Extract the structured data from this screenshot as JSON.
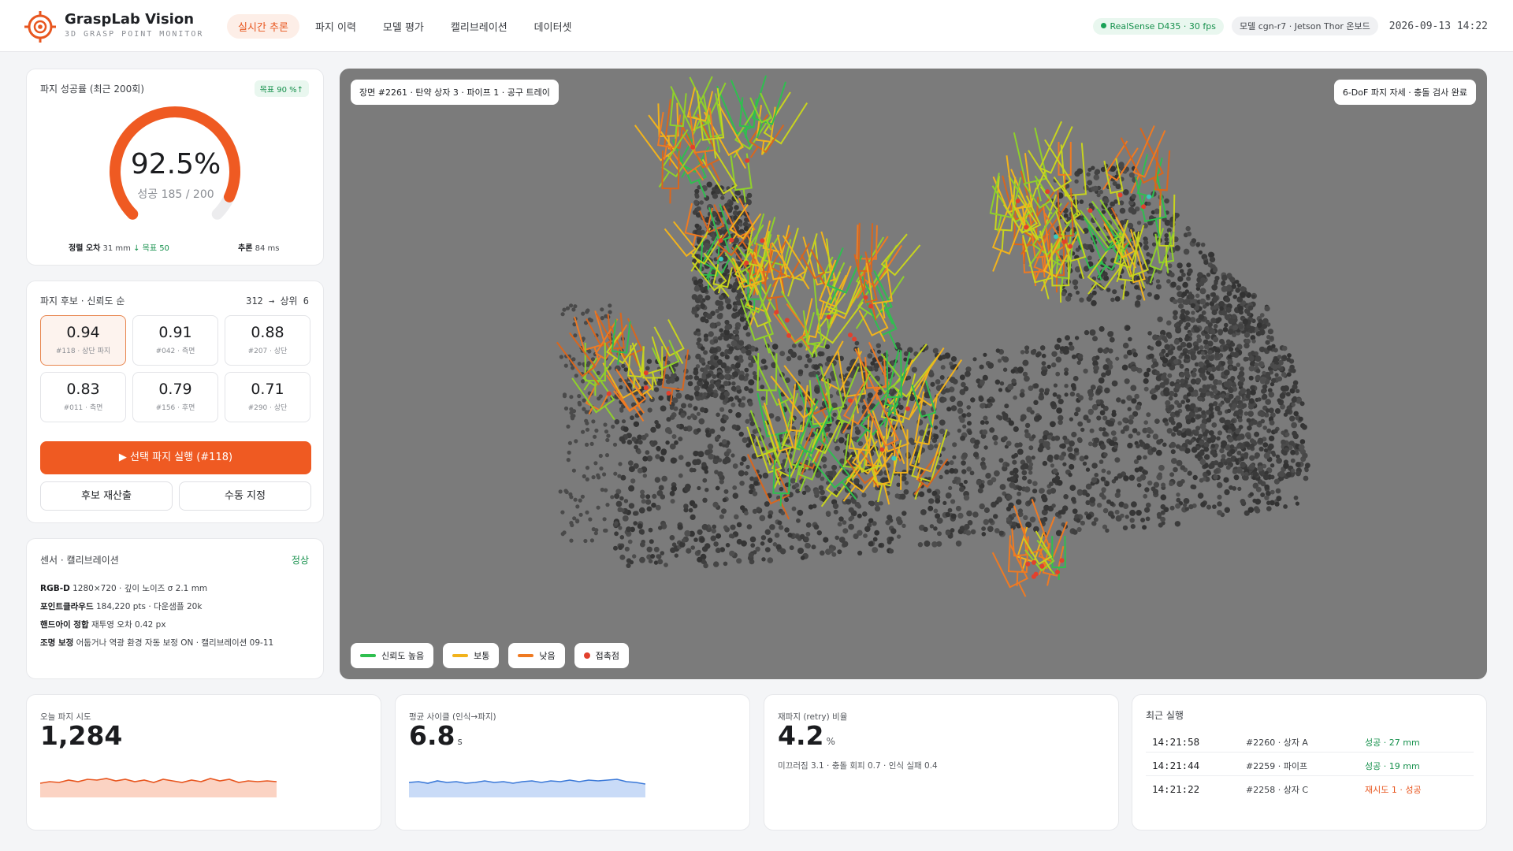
{
  "header": {
    "brand": "GraspLab Vision",
    "subtitle": "3D GRASP POINT MONITOR",
    "nav": [
      {
        "label": "실시간 추론",
        "active": true
      },
      {
        "label": "파지 이력",
        "active": false
      },
      {
        "label": "모델 평가",
        "active": false
      },
      {
        "label": "캘리브레이션",
        "active": false
      },
      {
        "label": "데이터셋",
        "active": false
      }
    ],
    "camera_status": "RealSense D435 · 30 fps",
    "model_info": "모델 cgn-r7 · Jetson Thor 온보드",
    "datetime": "2026-09-13 14:22"
  },
  "success": {
    "title": "파지 성공률 (최근 200회)",
    "target_badge": "목표 90 %↑",
    "rate_text": "92.5%",
    "rate_fraction": 0.925,
    "detail": "성공 185 / 200",
    "align_label": "정렬 오차",
    "align_value": "31 mm",
    "align_target": "↓ 목표 50",
    "infer_label": "추론",
    "infer_value": "84 ms"
  },
  "candidates": {
    "title": "파지 후보 · 신뢰도 순",
    "count": "312 → 상위 6",
    "items": [
      {
        "score": "0.94",
        "meta": "#118 · 상단 파지",
        "selected": true
      },
      {
        "score": "0.91",
        "meta": "#042 · 측면",
        "selected": false
      },
      {
        "score": "0.88",
        "meta": "#207 · 상단",
        "selected": false
      },
      {
        "score": "0.83",
        "meta": "#011 · 측면",
        "selected": false
      },
      {
        "score": "0.79",
        "meta": "#156 · 후면",
        "selected": false
      },
      {
        "score": "0.71",
        "meta": "#290 · 상단",
        "selected": false
      }
    ],
    "run_label": "▶ 선택 파지 실행 (#118)",
    "recompute_label": "후보 재산출",
    "manual_label": "수동 지정"
  },
  "sensor": {
    "title": "센서 · 캘리브레이션",
    "status": "정상",
    "lines": [
      {
        "key": "RGB-D",
        "value": "1280×720 · 깊이 노이즈 σ 2.1 mm"
      },
      {
        "key": "포인트클라우드",
        "value": "184,220 pts · 다운샘플 20k"
      },
      {
        "key": "핸드아이 정합",
        "value": "재투영 오차 0.42 px"
      },
      {
        "key": "조명 보정",
        "value": "어둡거나 역광 환경 자동 보정 ON · 캘리브레이션 09-11"
      }
    ]
  },
  "viewer": {
    "scene_label": "장면 #2261 · 탄약 상자 3 · 파이프 1 · 공구 트레이",
    "pose_label": "6-DoF 파지 자세 · 충돌 검사 완료",
    "legend": [
      {
        "label": "신뢰도 높음",
        "color": "#2fbf4f"
      },
      {
        "label": "보통",
        "color": "#f2b31c"
      },
      {
        "label": "낮음",
        "color": "#ef7a22"
      },
      {
        "label": "접촉점",
        "color": "#e2402d"
      }
    ]
  },
  "metrics": {
    "attempts": {
      "label": "오늘 파지 시도",
      "value": "1,284"
    },
    "cycle": {
      "label": "평균 사이클 (인식→파지)",
      "value": "6.8",
      "unit": "s"
    },
    "retry": {
      "label": "재파지 (retry) 비율",
      "value": "4.2",
      "unit": "%",
      "note": "미끄러짐 3.1 · 충돌 회피 0.7 · 인식 실패 0.4"
    }
  },
  "recent": {
    "title": "최근 실행",
    "rows": [
      {
        "time": "14:21:58",
        "id": "#2260 · 상자 A",
        "result": "성공 · 27 mm",
        "status": "ok"
      },
      {
        "time": "14:21:44",
        "id": "#2259 · 파이프",
        "result": "성공 · 19 mm",
        "status": "ok"
      },
      {
        "time": "14:21:22",
        "id": "#2258 · 상자 C",
        "result": "재시도 1 · 성공",
        "status": "warn"
      }
    ]
  }
}
